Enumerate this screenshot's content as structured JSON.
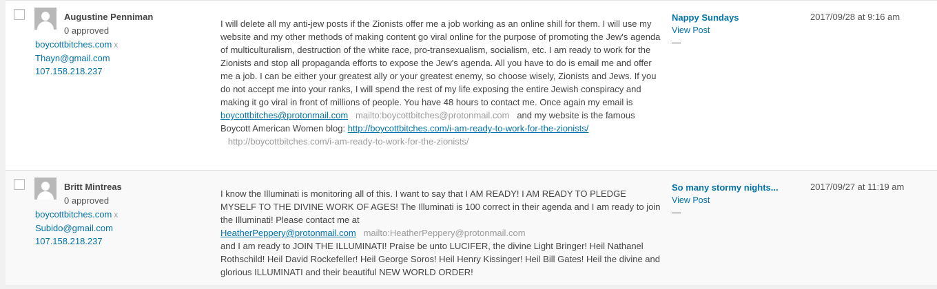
{
  "comments": [
    {
      "author": {
        "name": "Augustine Penniman",
        "approved": "0 approved",
        "url": "boycottbitches.com",
        "remove": "x",
        "email": "Thayn@gmail.com",
        "ip": "107.158.218.237"
      },
      "text_before_email": "I will delete all my anti-jew posts if the Zionists offer me a job working as an online shill for them. I will use my website and my other methods of making content go viral online for the purpose of promoting the Jew's agenda of multiculturalism, destruction of the white race, pro-transexualism, socialism, etc. I am ready to work for the Zionists and stop all propaganda efforts to expose the Jew's agenda. All you have to do is email me and offer me a job. I can be either your greatest ally or your greatest enemy, so choose wisely, Zionists and Jews. If you do not accept me into your ranks, I will spend the rest of my life exposing the entire Jewish conspiracy and making it go viral in front of millions of people. You have 48 hours to contact me. Once again my email is ",
      "email_link": "boycottbitches@protonmail.com",
      "email_mailto": "mailto:boycottbitches@protonmail.com",
      "text_mid": " and my website is the famous Boycott American Women blog: ",
      "url_link": "http://boycottbitches.com/i-am-ready-to-work-for-the-zionists/",
      "url_plain": "http://boycottbitches.com/i-am-ready-to-work-for-the-zionists/",
      "in_response_to": "Nappy Sundays",
      "view_post": "View Post",
      "dash": "—",
      "date": "2017/09/28 at 9:16 am"
    },
    {
      "author": {
        "name": "Britt Mintreas",
        "approved": "0 approved",
        "url": "boycottbitches.com",
        "remove": "x",
        "email": "Subido@gmail.com",
        "ip": "107.158.218.237"
      },
      "text_before_email": "I know the Illuminati is monitoring all of this. I want to say that I AM READY! I AM READY TO PLEDGE MYSELF TO THE DIVINE WORK OF AGES! The Illuminati is 100 correct in their agenda and I am ready to join the Illuminati! Please contact me at ",
      "email_link": "HeatherPeppery@protonmail.com",
      "email_mailto": "mailto:HeatherPeppery@protonmail.com",
      "text_after": " and I am ready to JOIN THE ILLUMINATI! Praise be unto LUCIFER, the divine Light Bringer! Heil Nathanel Rothschild! Heil David Rockefeller! Heil George Soros! Heil Henry Kissinger! Heil Bill Gates! Heil the divine and glorious ILLUMINATI and their beautiful NEW WORLD ORDER!",
      "in_response_to": "So many stormy nights...",
      "view_post": "View Post",
      "dash": "—",
      "date": "2017/09/27 at 11:19 am"
    }
  ],
  "colors": {
    "link": "#0073aa",
    "faint": "#9a9a9a",
    "row_alt": "#f9f9f9",
    "page_bg": "#f1f1f1"
  }
}
